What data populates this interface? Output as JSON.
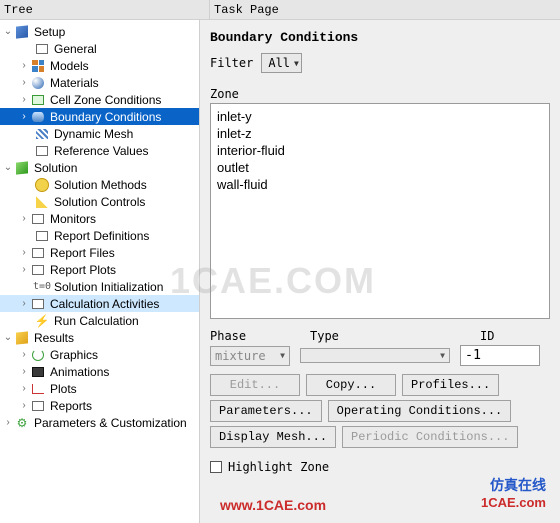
{
  "cols": {
    "tree": "Tree",
    "task": "Task Page"
  },
  "tree": {
    "setup": {
      "label": "Setup",
      "general": "General",
      "models": "Models",
      "materials": "Materials",
      "cell_zone": "Cell Zone Conditions",
      "boundary": "Boundary Conditions",
      "dyn_mesh": "Dynamic Mesh",
      "ref_vals": "Reference Values"
    },
    "solution": {
      "label": "Solution",
      "methods": "Solution Methods",
      "controls": "Solution Controls",
      "monitors": "Monitors",
      "rep_def": "Report Definitions",
      "rep_files": "Report Files",
      "rep_plots": "Report Plots",
      "init": "Solution Initialization",
      "calc_act": "Calculation Activities",
      "run": "Run Calculation"
    },
    "results": {
      "label": "Results",
      "graphics": "Graphics",
      "anim": "Animations",
      "plots": "Plots",
      "reports": "Reports"
    },
    "params": "Parameters & Customization"
  },
  "task": {
    "title": "Boundary Conditions",
    "filter_label": "Filter",
    "filter_value": "All",
    "zone_label": "Zone",
    "zones": [
      "inlet-y",
      "inlet-z",
      "interior-fluid",
      "outlet",
      "wall-fluid"
    ],
    "phase_label": "Phase",
    "phase_value": "mixture",
    "type_label": "Type",
    "type_value": "",
    "id_label": "ID",
    "id_value": "-1",
    "btn_edit": "Edit...",
    "btn_copy": "Copy...",
    "btn_profiles": "Profiles...",
    "btn_params": "Parameters...",
    "btn_opcond": "Operating Conditions...",
    "btn_disp": "Display Mesh...",
    "btn_periodic": "Periodic Conditions...",
    "highlight": "Highlight Zone"
  },
  "wm": {
    "big": "1CAE.COM",
    "url": "www.1CAE.com",
    "zh": "仿真在线",
    "url2": "1CAE.com"
  }
}
